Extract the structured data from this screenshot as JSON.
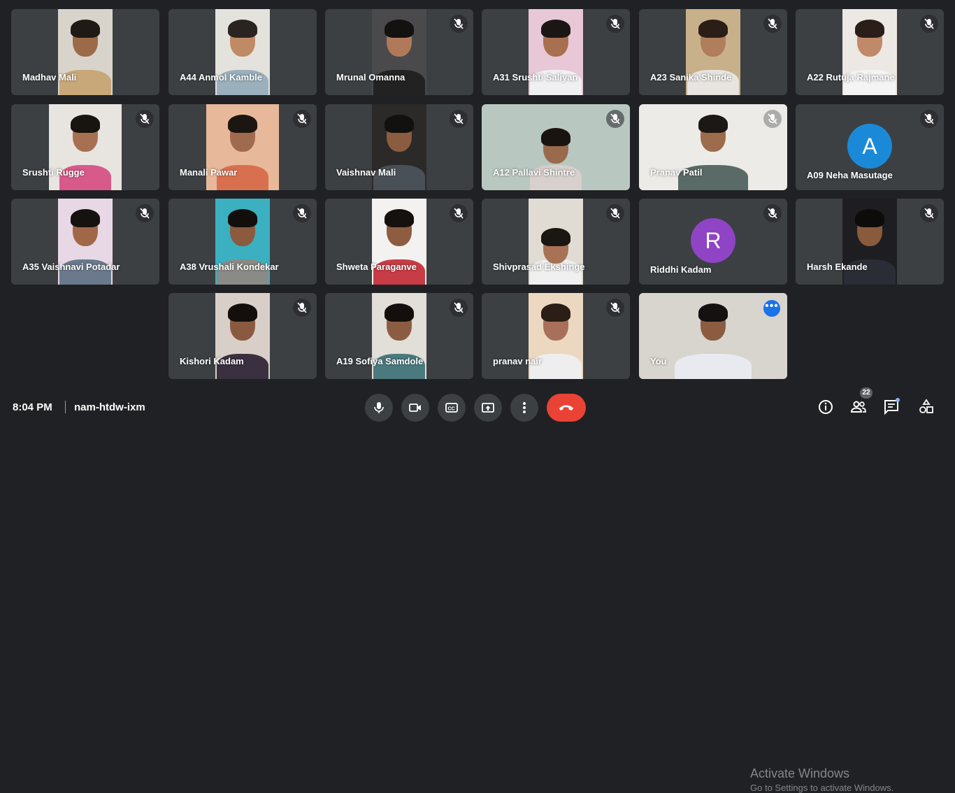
{
  "participants": [
    {
      "name": "Madhav Mali"
    },
    {
      "name": "A44 Anmol Kamble"
    },
    {
      "name": "Mrunal Omanna"
    },
    {
      "name": "A31 Srushti Saliyan"
    },
    {
      "name": "A23 Sanika Shinde"
    },
    {
      "name": "A22 Rutuja Rajmane"
    },
    {
      "name": "Srushti Rugge"
    },
    {
      "name": "Manali Pawar"
    },
    {
      "name": "Vaishnav Mali"
    },
    {
      "name": "A12 Pallavi Shintre"
    },
    {
      "name": "Pranav Patil"
    },
    {
      "name": "A09 Neha Masutage",
      "avatar_letter": "A",
      "avatar_color": "#1a8ad8"
    },
    {
      "name": "A35 Vaishnavi Potadar"
    },
    {
      "name": "A38 Vrushali Kondekar"
    },
    {
      "name": "Shweta Paraganve"
    },
    {
      "name": "Shivprasad Ekshinge"
    },
    {
      "name": "Riddhi Kadam",
      "avatar_letter": "R",
      "avatar_color": "#8e44c4"
    },
    {
      "name": "Harsh Ekande"
    },
    {
      "name": "Kishori Kadam"
    },
    {
      "name": "A19 Sofiya Samdole"
    },
    {
      "name": "pranav nair"
    },
    {
      "name": "You"
    }
  ],
  "meeting": {
    "time": "8:04 PM",
    "code": "nam-htdw-ixm",
    "participant_count": "22"
  },
  "controls": {
    "mic": "microphone-icon",
    "camera": "camera-icon",
    "captions": "captions-icon",
    "present": "present-screen-icon",
    "more": "more-options-icon",
    "end_call": "end-call-icon"
  },
  "watermark": {
    "line1": "Activate Windows",
    "line2": "Go to Settings to activate Windows."
  },
  "colors": {
    "background": "#202124",
    "tile": "#3c4043",
    "end_call": "#ea4335",
    "accent": "#1a73e8"
  }
}
